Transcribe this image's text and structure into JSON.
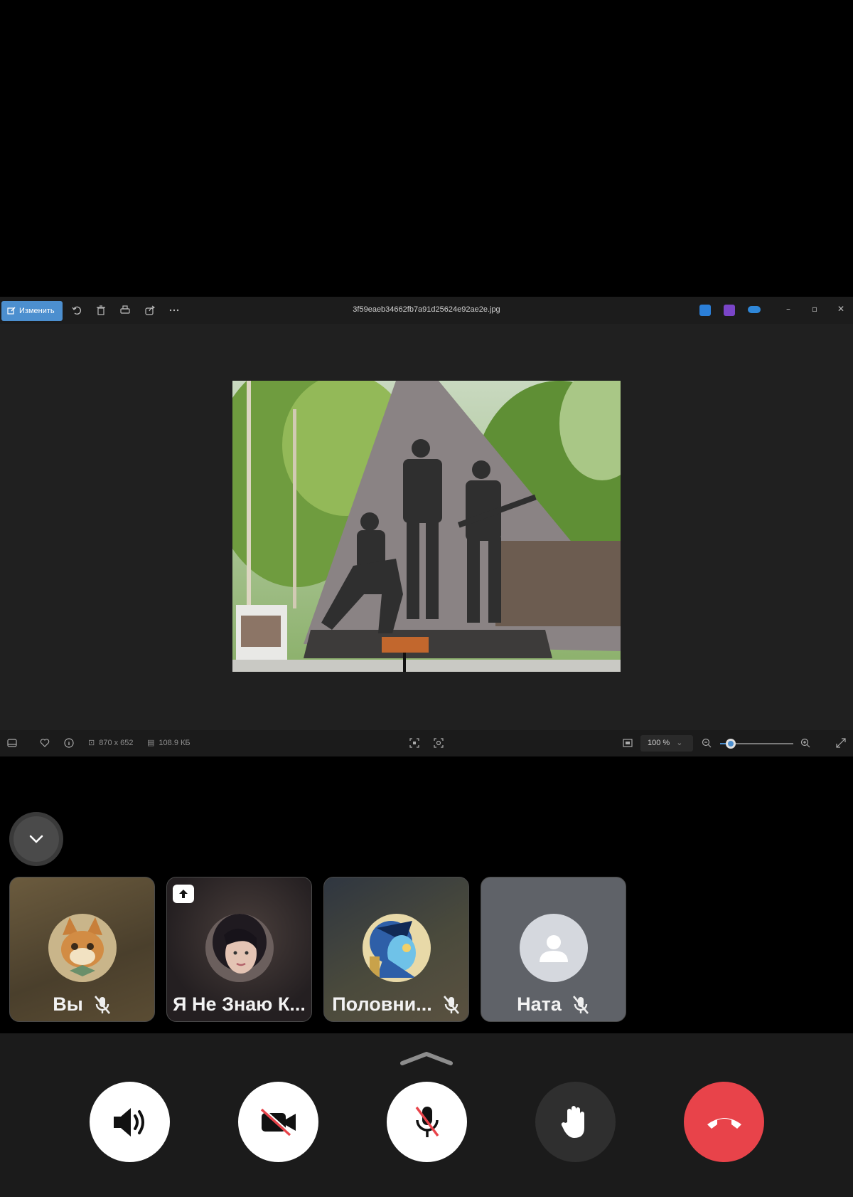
{
  "viewer": {
    "edit_label": "Изменить",
    "filename": "3f59eaeb34662fb7a91d25624e92ae2e.jpg",
    "dimensions": "870 x 652",
    "filesize": "108.9 КБ",
    "zoom": "100 %",
    "zoom_level_fraction": 0.15
  },
  "participants": [
    {
      "name": "Вы",
      "muted": true
    },
    {
      "name": "Я Не Знаю К...",
      "muted": false,
      "sharing": true
    },
    {
      "name": "Половни...",
      "muted": true
    },
    {
      "name": "Ната",
      "muted": true
    }
  ],
  "controls": {
    "speaker": "speaker-icon",
    "camera": "camera-off-icon",
    "mic": "mic-off-icon",
    "hand": "raise-hand-icon",
    "hangup": "hangup-icon",
    "hangup_color": "#e8434a"
  }
}
